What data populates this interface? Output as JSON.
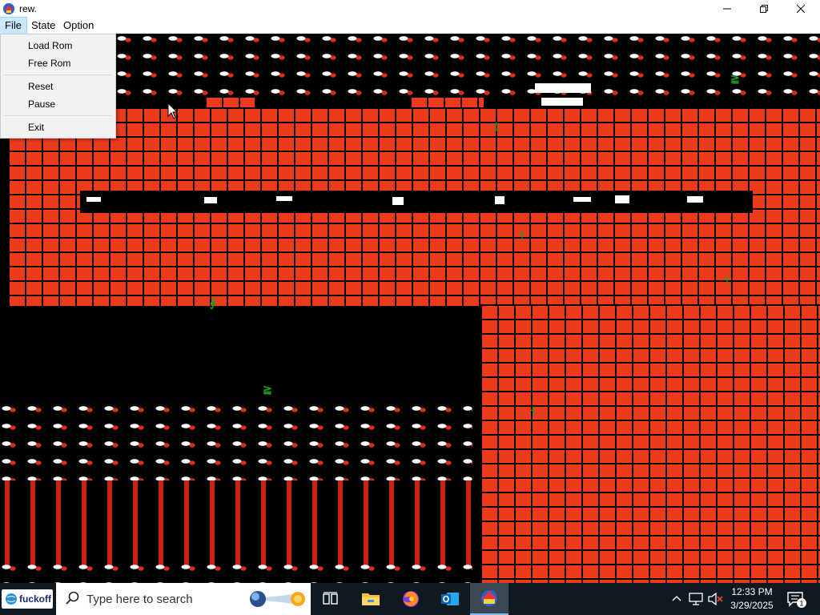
{
  "window": {
    "title": "rew.",
    "icon": "rew-app-icon",
    "controls": [
      "minimize-icon",
      "maximize-icon",
      "close-icon"
    ]
  },
  "menubar": {
    "items": [
      {
        "label": "File",
        "active": true
      },
      {
        "label": "State"
      },
      {
        "label": "Option"
      }
    ]
  },
  "file_menu": {
    "items": [
      "Load Rom",
      "Free Rom",
      "Reset",
      "Pause",
      "Exit"
    ]
  },
  "taskbar": {
    "start_label": "fuckoff",
    "search_placeholder": "Type here to search",
    "pinned": [
      "task-view-icon",
      "file-explorer-icon",
      "firefox-icon",
      "outlook-icon",
      "rew-app-icon"
    ],
    "tray": {
      "time": "12:33 PM",
      "date": "3/29/2025",
      "notification_count": "1"
    }
  },
  "colors": {
    "brick": "#ec3a1c",
    "taskbar": "#101820",
    "menu_highlight": "#cce8ff"
  }
}
